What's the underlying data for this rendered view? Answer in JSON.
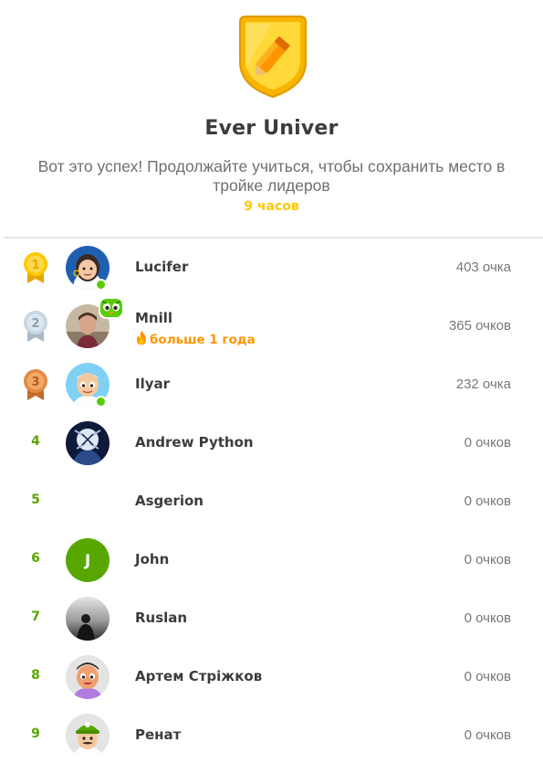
{
  "league": {
    "title": "Ever Univer",
    "subtitle": "Вот это успех! Продолжайте учиться, чтобы сохранить место в тройке лидеров",
    "time_left": "9 часов",
    "badge_icon": "pencil-shield-icon",
    "accent_color": "#ffc800"
  },
  "leaderboard": [
    {
      "rank": "1",
      "name": "Lucifer",
      "points": "403 очка",
      "medal": "gold",
      "online": true
    },
    {
      "rank": "2",
      "name": "Mnill",
      "points": "365 очков",
      "medal": "silver",
      "streak": "больше 1 года",
      "owl_badge": true
    },
    {
      "rank": "3",
      "name": "Ilyar",
      "points": "232 очка",
      "medal": "bronze",
      "online": true
    },
    {
      "rank": "4",
      "name": "Andrew Python",
      "points": "0 очков"
    },
    {
      "rank": "5",
      "name": "Asgerion",
      "points": "0 очков"
    },
    {
      "rank": "6",
      "name": "John",
      "points": "0 очков",
      "initial": "J"
    },
    {
      "rank": "7",
      "name": "Ruslan",
      "points": "0 очков"
    },
    {
      "rank": "8",
      "name": "Артем Стріжков",
      "points": "0 очков"
    },
    {
      "rank": "9",
      "name": "Ренат",
      "points": "0 очков"
    }
  ]
}
